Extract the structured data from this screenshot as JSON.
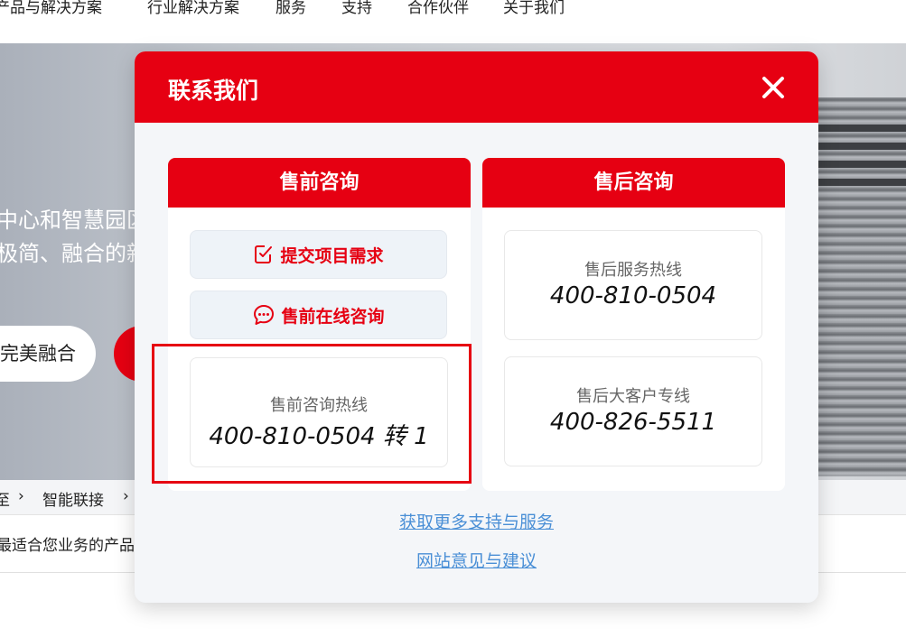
{
  "topnav": {
    "items": [
      "产品与解决方案",
      "行业解决方案",
      "服务",
      "支持",
      "合作伙伴",
      "关于我们"
    ]
  },
  "hero": {
    "line1": "中心和智慧园区",
    "line2": "极简、融合的新",
    "pill_label": "完美融合"
  },
  "breadcrumb": {
    "items": [
      "至",
      "›",
      "智能联接",
      "›"
    ]
  },
  "page": {
    "subtitle": "最适合您业务的产品"
  },
  "modal": {
    "title": "联系我们",
    "close_icon": "close-icon",
    "presales": {
      "heading": "售前咨询",
      "submit_label": "提交项目需求",
      "submit_icon": "checkbox-edit-icon",
      "online_label": "售前在线咨询",
      "online_icon": "chat-bubble-icon",
      "hotline_label": "售前咨询热线",
      "hotline_number": "400-810-0504 转 1"
    },
    "aftersales": {
      "heading": "售后咨询",
      "service_label": "售后服务热线",
      "service_number": "400-810-0504",
      "vip_label": "售后大客户专线",
      "vip_number": "400-826-5511"
    },
    "links": {
      "more_support": "获取更多支持与服务",
      "feedback": "网站意见与建议"
    }
  },
  "colors": {
    "brand_red": "#e60012",
    "link_blue": "#4a8fd6",
    "modal_bg": "#f4f6f9",
    "button_bg": "#eef3f8"
  }
}
